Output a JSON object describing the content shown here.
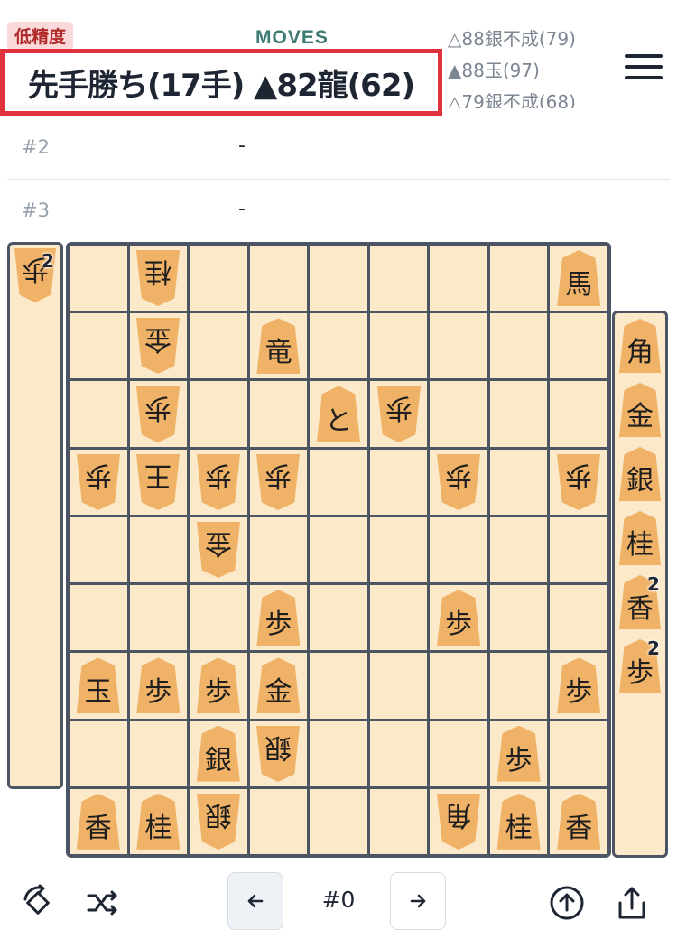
{
  "header": {
    "precision_badge": "低精度",
    "moves_label": "MOVES",
    "result": "先手勝ち(17手) ▲82龍(62)",
    "history": [
      "△88銀不成(79)",
      "▲88玉(97)",
      "△79銀不成(68)"
    ]
  },
  "variations": [
    {
      "num": "#2",
      "value": "-"
    },
    {
      "num": "#3",
      "value": "-"
    }
  ],
  "gote_hand": [
    {
      "piece": "歩",
      "count": "2"
    }
  ],
  "sente_hand": [
    {
      "piece": "角",
      "count": ""
    },
    {
      "piece": "金",
      "count": ""
    },
    {
      "piece": "銀",
      "count": ""
    },
    {
      "piece": "桂",
      "count": ""
    },
    {
      "piece": "香",
      "count": "2"
    },
    {
      "piece": "歩",
      "count": "2"
    }
  ],
  "board": [
    [
      "",
      "桂v",
      "",
      "",
      "",
      "",
      "",
      "",
      "馬"
    ],
    [
      "",
      "金v",
      "",
      "竜",
      "",
      "",
      "",
      "",
      ""
    ],
    [
      "",
      "歩v",
      "",
      "",
      "と",
      "歩v",
      "",
      "",
      ""
    ],
    [
      "歩v",
      "王v",
      "歩v",
      "歩v",
      "",
      "",
      "歩v",
      "",
      "歩v"
    ],
    [
      "",
      "",
      "金v",
      "",
      "",
      "",
      "",
      "",
      ""
    ],
    [
      "",
      "",
      "",
      "歩",
      "",
      "",
      "歩",
      "",
      ""
    ],
    [
      "玉",
      "歩",
      "歩",
      "金",
      "",
      "",
      "",
      "",
      "歩"
    ],
    [
      "",
      "",
      "銀",
      "銀v",
      "",
      "",
      "",
      "歩",
      ""
    ],
    [
      "香",
      "桂",
      "銀v",
      "",
      "",
      "",
      "角v",
      "桂",
      "香"
    ]
  ],
  "footer": {
    "move_counter": "#0",
    "prev_icon": "arrow-left-icon",
    "next_icon": "arrow-right-icon",
    "rotate_icon": "rotate-board-icon",
    "shuffle_icon": "shuffle-icon",
    "upload_icon": "arrow-up-circle-icon",
    "share_icon": "share-icon"
  },
  "colors": {
    "board_bg": "#fbe9c9",
    "piece": "#f0b266",
    "grid": "#4b5563",
    "highlight": "#e0323c",
    "moves_label": "#3b7a72"
  }
}
